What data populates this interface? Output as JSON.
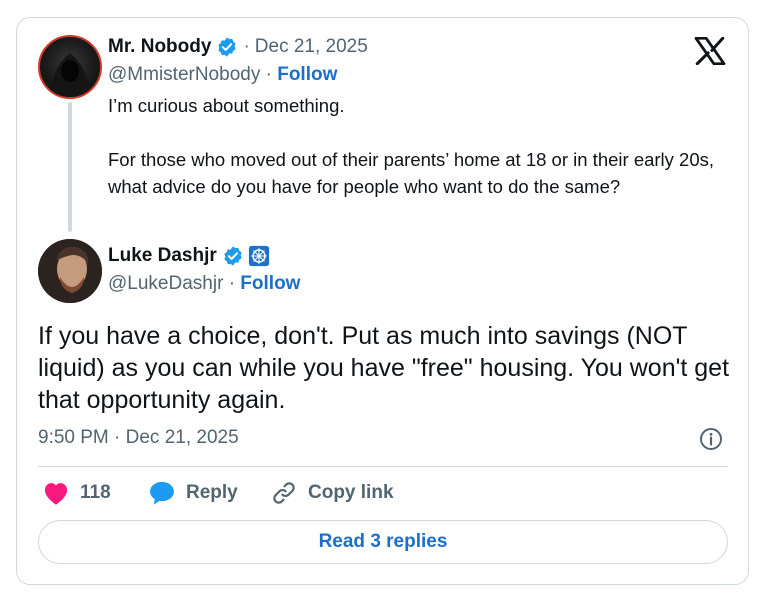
{
  "parent_tweet": {
    "name": "Mr. Nobody",
    "date": "Dec 21, 2025",
    "handle": "@MmisterNobody",
    "follow_label": "Follow",
    "paragraphs": [
      "I’m curious about something.",
      "For those who moved out of their parents’ home at 18 or in their early 20s, what advice do you have for people who want to do the same?"
    ]
  },
  "reply_tweet": {
    "name": "Luke Dashjr",
    "handle": "@LukeDashjr",
    "follow_label": "Follow",
    "text": "If you have a choice, don't. Put as much into savings (NOT liquid) as you can while you have \"free\" housing. You won't get that opportunity again.",
    "timestamp": "9:50 PM · Dec 21, 2025"
  },
  "separator": "·",
  "actions": {
    "like_count": "118",
    "reply_label": "Reply",
    "copy_link_label": "Copy link"
  },
  "read_replies_label": "Read 3 replies",
  "colors": {
    "accent": "#1d6fc9",
    "verified": "#1d9bf0",
    "like": "#f91880",
    "muted": "#536471",
    "border": "#cfd9de"
  },
  "icons": [
    "x-logo-icon",
    "verified-badge-icon",
    "affiliate-badge-icon",
    "info-icon",
    "heart-icon",
    "reply-bubble-icon",
    "link-icon"
  ]
}
